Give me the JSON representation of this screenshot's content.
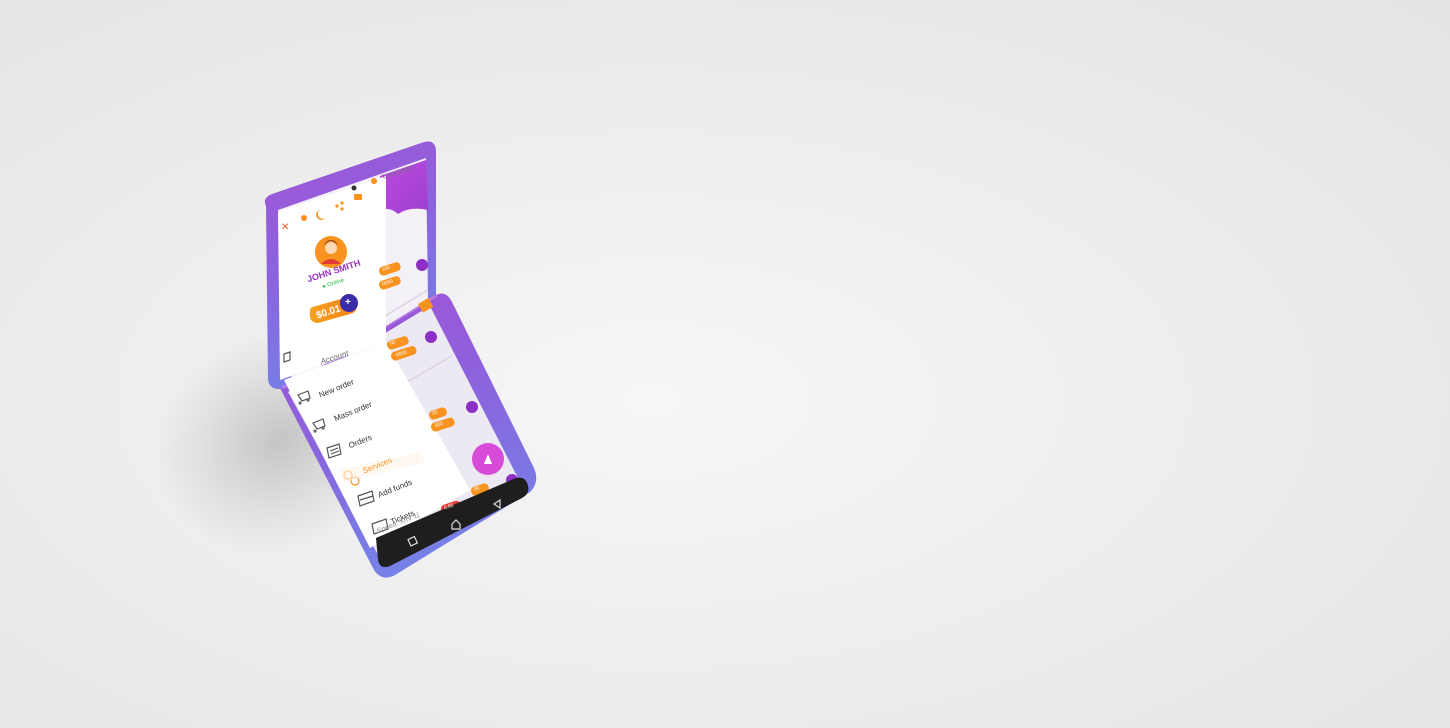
{
  "device": {
    "colors": {
      "case_top": "#9a4fd6",
      "case_bottom": "#7d79e6",
      "header_purple": "#b23ed8",
      "accent_orange": "#f7931e",
      "fab_magenta": "#d84ad8",
      "navbar": "#222222"
    }
  },
  "app": {
    "top_bar": {
      "language_label": "Language"
    },
    "drawer": {
      "icons": [
        "close-icon",
        "user-icon",
        "moon-icon",
        "share-icon",
        "card-icon",
        "bulb-icon"
      ],
      "user": {
        "name": "JOHN SMITH",
        "status": "Online"
      },
      "balance": "$0.01",
      "add_funds_symbol": "+",
      "section_label": "Account",
      "menu": [
        {
          "label": "New order",
          "icon": "cart-icon"
        },
        {
          "label": "Mass order",
          "icon": "cart-icon"
        },
        {
          "label": "Orders",
          "icon": "list-icon"
        },
        {
          "label": "Services",
          "icon": "services-icon",
          "active": true
        },
        {
          "label": "Add funds",
          "icon": "wallet-icon"
        },
        {
          "label": "Tickets",
          "icon": "ticket-icon"
        }
      ]
    },
    "background_list": {
      "chips": [
        "100",
        "0000",
        "00",
        "0000",
        "20",
        "000",
        "00",
        "0.85"
      ],
      "speed_text": "Speed: X/hr 1|"
    },
    "navbar": {
      "buttons": [
        "recent-apps-icon",
        "home-icon",
        "back-icon"
      ]
    }
  }
}
